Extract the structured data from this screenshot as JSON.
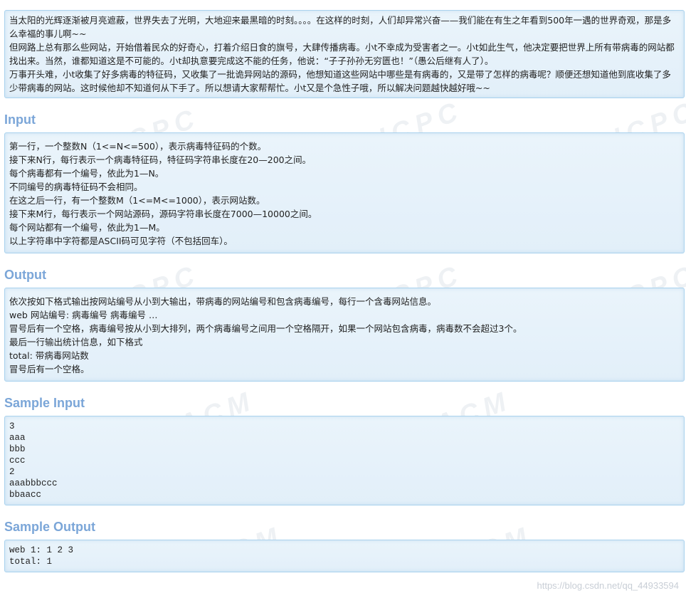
{
  "description_lines": [
    "当太阳的光辉逐渐被月亮遮蔽，世界失去了光明，大地迎来最黑暗的时刻。。。。在这样的时刻，人们却异常兴奋——我们能在有生之年看到500年一遇的世界奇观，那是多么幸福的事儿啊~~",
    "但网路上总有那么些网站，开始借着民众的好奇心，打着介绍日食的旗号，大肆传播病毒。小t不幸成为受害者之一。小t如此生气，他决定要把世界上所有带病毒的网站都找出来。当然，谁都知道这是不可能的。小t却执意要完成这不能的任务，他说：“子子孙孙无穷匮也！”（愚公后继有人了）。",
    "万事开头难，小t收集了好多病毒的特征码，又收集了一批诡异网站的源码，他想知道这些网站中哪些是有病毒的，又是带了怎样的病毒呢？顺便还想知道他到底收集了多少带病毒的网站。这时候他却不知道何从下手了。所以想请大家帮帮忙。小t又是个急性子哦，所以解决问题越快越好哦~~"
  ],
  "input": {
    "title": "Input",
    "lines": [
      "第一行，一个整数N（1<=N<=500），表示病毒特征码的个数。",
      "接下来N行，每行表示一个病毒特征码，特征码字符串长度在20—200之间。",
      "每个病毒都有一个编号，依此为1—N。",
      "不同编号的病毒特征码不会相同。",
      "在这之后一行，有一个整数M（1<=M<=1000），表示网站数。",
      "接下来M行，每行表示一个网站源码，源码字符串长度在7000—10000之间。",
      "每个网站都有一个编号，依此为1—M。",
      "以上字符串中字符都是ASCII码可见字符（不包括回车）。"
    ]
  },
  "output": {
    "title": "Output",
    "lines": [
      "依次按如下格式输出按网站编号从小到大输出，带病毒的网站编号和包含病毒编号，每行一个含毒网站信息。",
      "web 网站编号: 病毒编号 病毒编号 …",
      "冒号后有一个空格，病毒编号按从小到大排列，两个病毒编号之间用一个空格隔开，如果一个网站包含病毒，病毒数不会超过3个。",
      "最后一行输出统计信息，如下格式",
      "total: 带病毒网站数",
      "冒号后有一个空格。"
    ]
  },
  "sample_input": {
    "title": "Sample Input",
    "lines": [
      "3",
      "aaa",
      "bbb",
      "ccc",
      "2",
      "aaabbbccc",
      "bbaacc"
    ]
  },
  "sample_output": {
    "title": "Sample Output",
    "lines": [
      "web 1: 1 2 3",
      "total: 1"
    ]
  },
  "credit": "https://blog.csdn.net/qq_44933594",
  "colors": {
    "heading": "#7ba6d8",
    "panel_bg": "#e6f1fa",
    "panel_border": "#a9d2ee"
  }
}
